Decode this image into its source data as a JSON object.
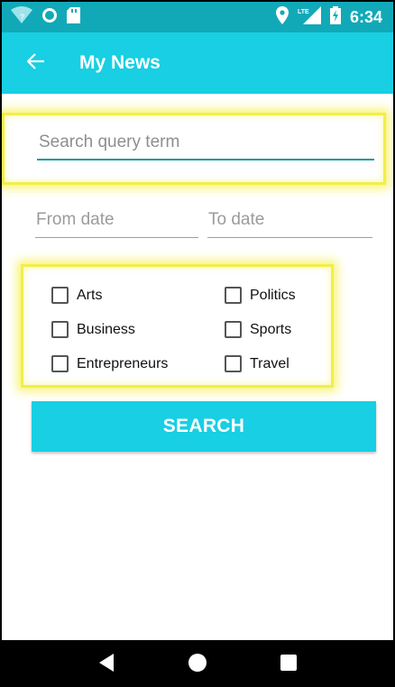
{
  "status_bar": {
    "time": "6:34",
    "icons": [
      "wifi-icon",
      "circle-icon",
      "sd-card-icon",
      "location-icon",
      "lte-signal-icon",
      "battery-charging-icon"
    ]
  },
  "app_bar": {
    "title": "My News",
    "back_icon": "arrow-left-icon"
  },
  "search": {
    "placeholder": "Search query term",
    "value": ""
  },
  "dates": {
    "from_placeholder": "From date",
    "to_placeholder": "To date"
  },
  "categories": [
    {
      "label": "Arts",
      "checked": false
    },
    {
      "label": "Politics",
      "checked": false
    },
    {
      "label": "Business",
      "checked": false
    },
    {
      "label": "Sports",
      "checked": false
    },
    {
      "label": "Entrepreneurs",
      "checked": false
    },
    {
      "label": "Travel",
      "checked": false
    }
  ],
  "search_button": {
    "label": "SEARCH"
  },
  "nav_bar": {
    "icons": [
      "back-triangle-icon",
      "home-circle-icon",
      "recents-square-icon"
    ]
  },
  "colors": {
    "status_bar": "#11a9b8",
    "app_bar": "#18cfe3",
    "accent_underline": "#159a9c",
    "highlight": "#f2ee4a"
  }
}
